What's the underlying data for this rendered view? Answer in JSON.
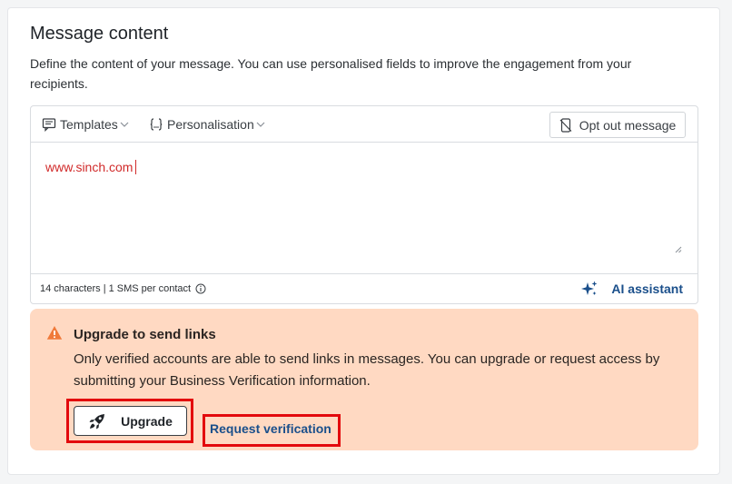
{
  "section": {
    "title": "Message content",
    "description": "Define the content of your message. You can use personalised fields to improve the engagement from your recipients."
  },
  "toolbar": {
    "templates_label": "Templates",
    "personalisation_label": "Personalisation",
    "optout_label": "Opt out message"
  },
  "editor": {
    "message_text": "www.sinch.com"
  },
  "footer": {
    "count_text": "14 characters | 1 SMS per contact",
    "ai_label": "AI assistant"
  },
  "alert": {
    "title": "Upgrade to send links",
    "body": "Only verified accounts are able to send links in messages. You can upgrade or request access by submitting your Business Verification information.",
    "upgrade_label": "Upgrade",
    "verify_label": "Request verification"
  },
  "icons": {
    "templates": "message-square-icon",
    "personalisation": "braces-icon",
    "optout": "phone-off-icon",
    "info": "info-icon",
    "ai": "sparkles-icon",
    "warning": "warning-triangle-icon",
    "upgrade": "rocket-icon"
  },
  "colors": {
    "link_red": "#d12b2b",
    "brand_blue": "#1a4f8b",
    "alert_bg": "#ffd9c2",
    "warning_orange": "#f07a3a",
    "highlight_red": "#e3090d"
  }
}
